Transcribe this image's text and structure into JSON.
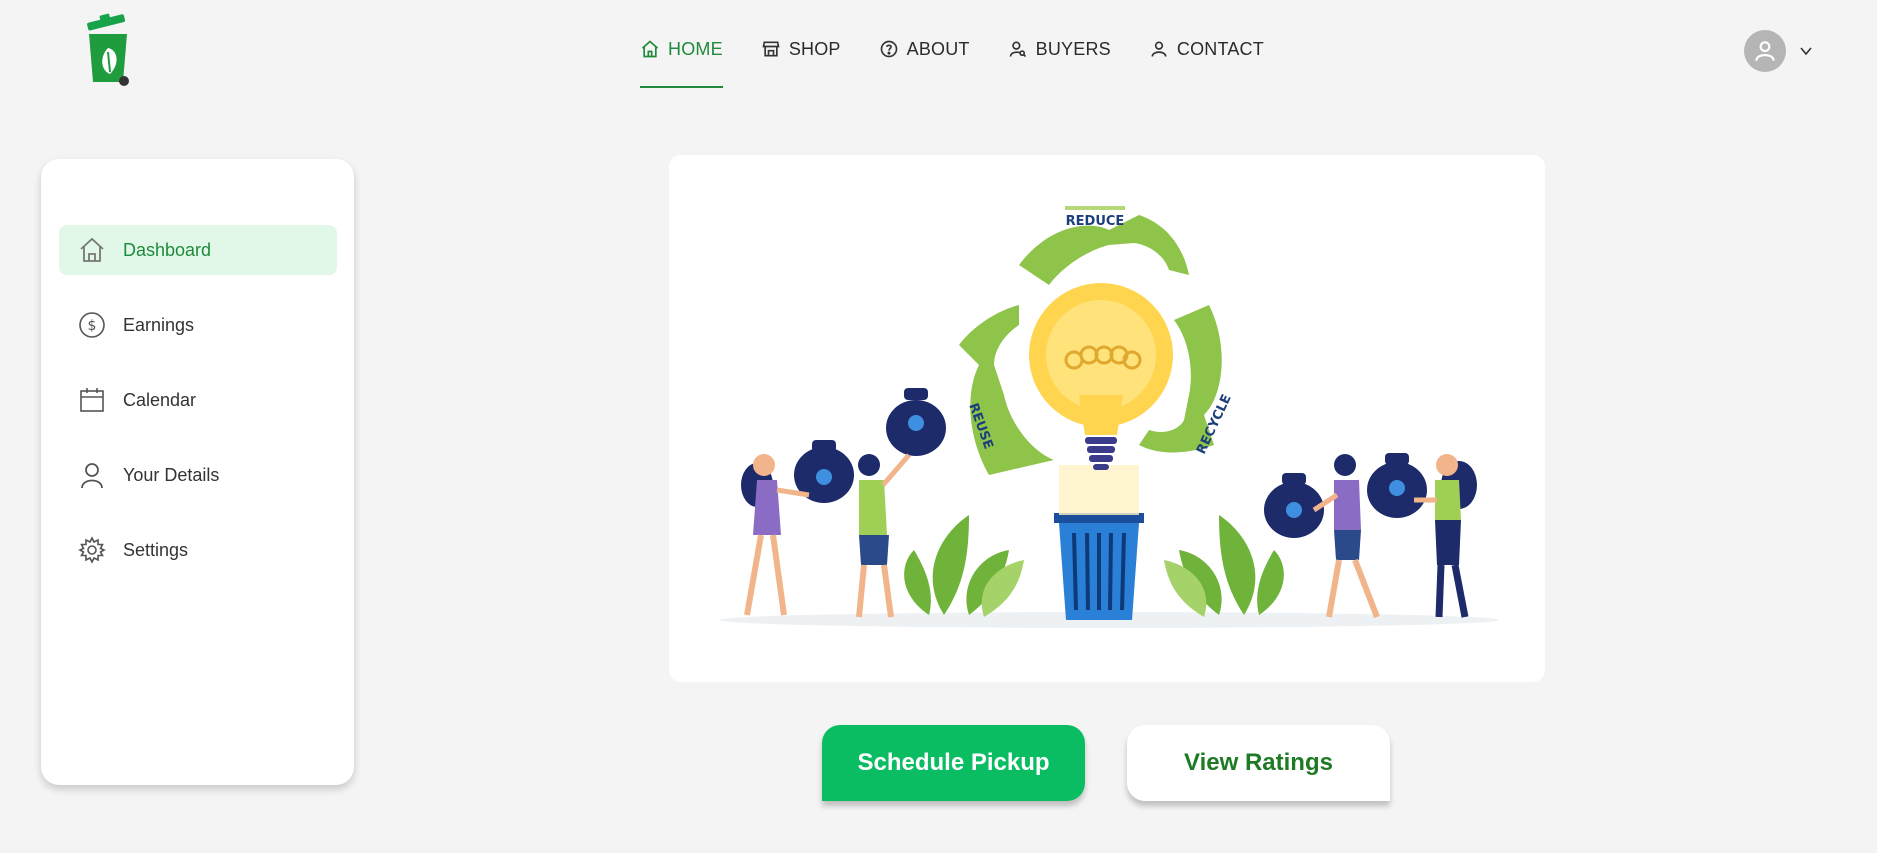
{
  "brand": {
    "logo_icon": "green-trash-bin-leaf-logo",
    "brand_color": "#1f8a3b"
  },
  "nav": {
    "items": [
      {
        "label": "HOME",
        "icon": "home-icon",
        "active": true
      },
      {
        "label": "SHOP",
        "icon": "store-icon",
        "active": false
      },
      {
        "label": "ABOUT",
        "icon": "help-circle-icon",
        "active": false
      },
      {
        "label": "BUYERS",
        "icon": "user-search-icon",
        "active": false
      },
      {
        "label": "CONTACT",
        "icon": "user-icon",
        "active": false
      }
    ]
  },
  "profile": {
    "avatar_icon": "user-avatar-icon",
    "menu_icon": "chevron-down-icon"
  },
  "sidebar": {
    "items": [
      {
        "label": "Dashboard",
        "icon": "home-icon",
        "active": true
      },
      {
        "label": "Earnings",
        "icon": "dollar-circle-icon",
        "active": false
      },
      {
        "label": "Calendar",
        "icon": "calendar-icon",
        "active": false
      },
      {
        "label": "Your Details",
        "icon": "user-icon",
        "active": false
      },
      {
        "label": "Settings",
        "icon": "gear-icon",
        "active": false
      }
    ]
  },
  "hero": {
    "labels": {
      "reduce": "REDUCE",
      "reuse": "REUSE",
      "recycle": "RECYCLE"
    }
  },
  "actions": {
    "primary_label": "Schedule Pickup",
    "secondary_label": "View Ratings"
  },
  "colors": {
    "accent": "#0bbd62",
    "active_bg": "#e1f8e8",
    "page_bg": "#f4f4f4"
  }
}
